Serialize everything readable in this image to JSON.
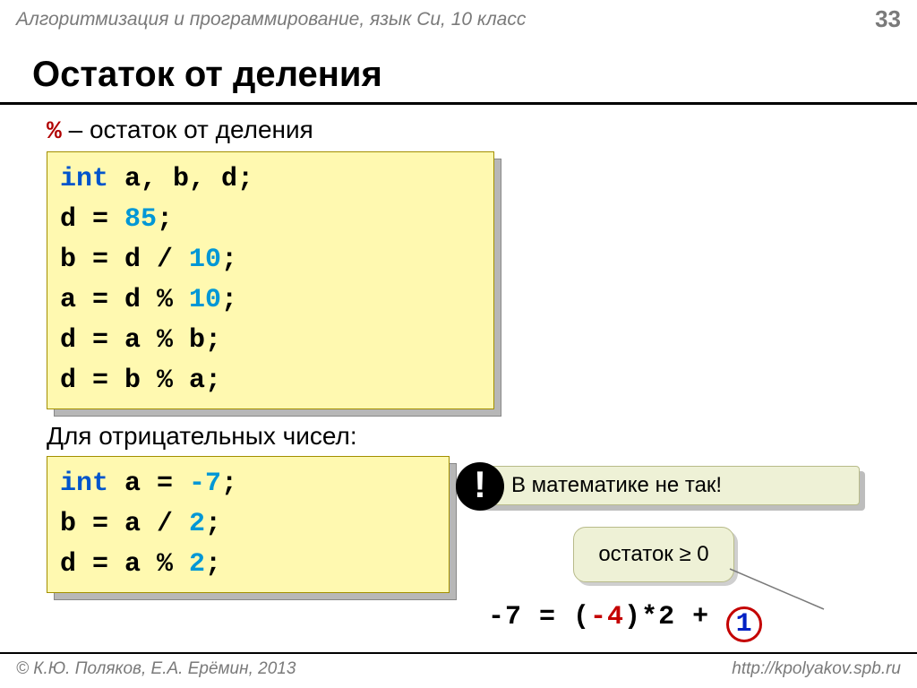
{
  "header": {
    "course": "Алгоритмизация и программирование, язык Си, 10 класс",
    "page": "33"
  },
  "title": "Остаток от деления",
  "definition": {
    "symbol": "%",
    "text": " – остаток от деления"
  },
  "code1": {
    "l1a": "int",
    "l1b": " a, b, d;",
    "l2a": "d = ",
    "l2b": "85",
    "l2c": ";",
    "l3a": "b = d / ",
    "l3b": "10",
    "l3c": ";",
    "l4a": "a = d % ",
    "l4b": "10",
    "l4c": ";",
    "l5": "d = a % b;",
    "l6": "d = b % a;"
  },
  "subhead": "Для отрицательных чисел:",
  "code2": {
    "l1a": "int",
    "l1b": " a = ",
    "l1c": "-7",
    "l1d": ";",
    "l2a": "b = a / ",
    "l2b": "2",
    "l2c": ";",
    "l3a": "d = a % ",
    "l3b": "2",
    "l3c": ";"
  },
  "banner": {
    "bang": "!",
    "text": "В математике не так!"
  },
  "badge": "остаток ≥ 0",
  "equation": {
    "lhs": "-7 = ",
    "paren_open": "(",
    "neg": "-4",
    "paren_close": ")",
    "mid": "*2  + ",
    "one": "1"
  },
  "footer": {
    "left": "© К.Ю. Поляков, Е.А. Ерёмин, 2013",
    "right": "http://kpolyakov.spb.ru"
  }
}
